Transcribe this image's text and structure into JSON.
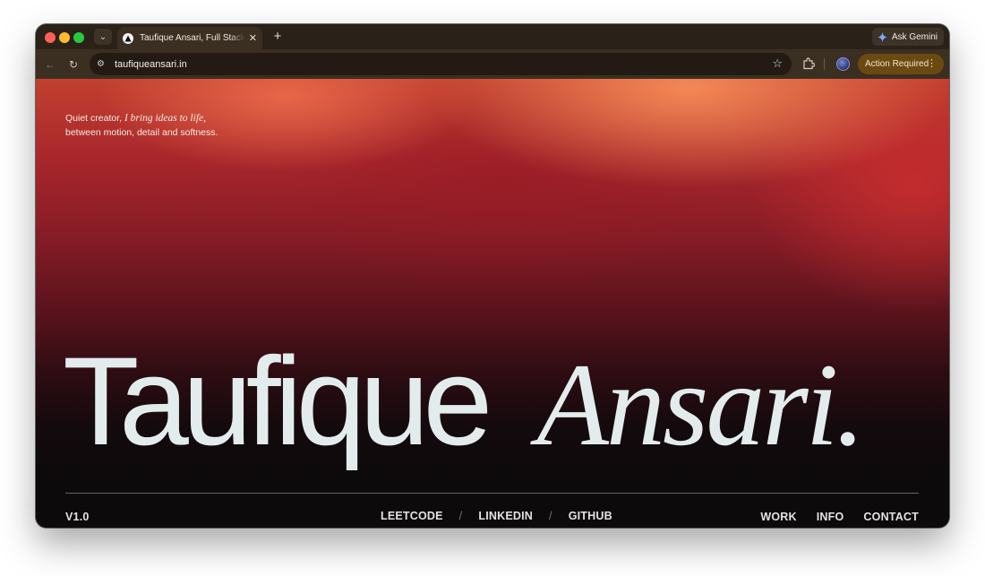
{
  "browser": {
    "tab_title": "Taufique Ansari, Full Stack Engineer",
    "tab_close": "✕",
    "new_tab": "+",
    "ask_gemini": "Ask Gemini",
    "url": "taufiqueansari.in",
    "action_required": "Action Required"
  },
  "hero": {
    "tagline_prefix": "Quiet creator,",
    "tagline_italic": "I bring ideas to life,",
    "tagline_line2": "between motion, detail and softness.",
    "first_name": "Taufique",
    "last_name": "Ansari."
  },
  "footer": {
    "version": "V1.0",
    "social": [
      "LEETCODE",
      "LINKEDIN",
      "GITHUB"
    ],
    "separator": "/",
    "menu": [
      "WORK",
      "INFO",
      "CONTACT"
    ]
  },
  "colors": {
    "accent_orange": "#f68c58",
    "deep_red": "#841b25",
    "hero_text": "#e3ecec",
    "page_bottom": "#0c0a0b"
  }
}
